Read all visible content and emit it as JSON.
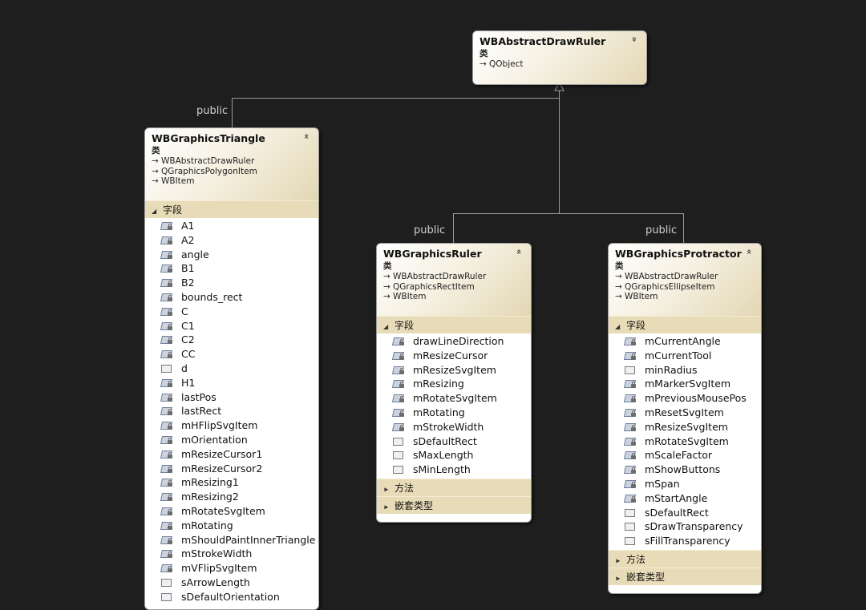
{
  "connector_label": "public",
  "kind_label": "类",
  "collapse_glyph": "«",
  "base_arrow_glyph": "→",
  "classes": {
    "abstract": {
      "name": "WBAbstractDrawRuler",
      "kind": "类",
      "bases": [
        "QObject"
      ]
    },
    "triangle": {
      "name": "WBGraphicsTriangle",
      "kind": "类",
      "bases": [
        "WBAbstractDrawRuler",
        "QGraphicsPolygonItem",
        "WBItem"
      ],
      "sections": [
        {
          "label": "字段",
          "expanded": true
        }
      ],
      "fields": [
        "A1",
        "A2",
        "angle",
        "B1",
        "B2",
        "bounds_rect",
        "C",
        "C1",
        "C2",
        "CC",
        "d",
        "H1",
        "lastPos",
        "lastRect",
        "mHFlipSvgItem",
        "mOrientation",
        "mResizeCursor1",
        "mResizeCursor2",
        "mResizing1",
        "mResizing2",
        "mRotateSvgItem",
        "mRotating",
        "mShouldPaintInnerTriangle",
        "mStrokeWidth",
        "mVFlipSvgItem",
        "sArrowLength",
        "sDefaultOrientation"
      ],
      "field_icons": [
        "lock",
        "lock",
        "lock",
        "lock",
        "lock",
        "lock",
        "lock",
        "lock",
        "lock",
        "lock",
        "plain",
        "lock",
        "lock",
        "lock",
        "lock",
        "lock",
        "lock",
        "lock",
        "lock",
        "lock",
        "lock",
        "lock",
        "lock",
        "lock",
        "lock",
        "plain",
        "plain"
      ]
    },
    "ruler": {
      "name": "WBGraphicsRuler",
      "kind": "类",
      "bases": [
        "WBAbstractDrawRuler",
        "QGraphicsRectItem",
        "WBItem"
      ],
      "sections": [
        {
          "label": "字段",
          "expanded": true
        },
        {
          "label": "方法",
          "expanded": false
        },
        {
          "label": "嵌套类型",
          "expanded": false
        }
      ],
      "fields": [
        "drawLineDirection",
        "mResizeCursor",
        "mResizeSvgItem",
        "mResizing",
        "mRotateSvgItem",
        "mRotating",
        "mStrokeWidth",
        "sDefaultRect",
        "sMaxLength",
        "sMinLength"
      ],
      "field_icons": [
        "lock",
        "lock",
        "lock",
        "lock",
        "lock",
        "lock",
        "lock",
        "plain",
        "plain",
        "plain"
      ]
    },
    "protractor": {
      "name": "WBGraphicsProtractor",
      "kind": "类",
      "bases": [
        "WBAbstractDrawRuler",
        "QGraphicsEllipseItem",
        "WBItem"
      ],
      "sections": [
        {
          "label": "字段",
          "expanded": true
        },
        {
          "label": "方法",
          "expanded": false
        },
        {
          "label": "嵌套类型",
          "expanded": false
        }
      ],
      "fields": [
        "mCurrentAngle",
        "mCurrentTool",
        "minRadius",
        "mMarkerSvgItem",
        "mPreviousMousePos",
        "mResetSvgItem",
        "mResizeSvgItem",
        "mRotateSvgItem",
        "mScaleFactor",
        "mShowButtons",
        "mSpan",
        "mStartAngle",
        "sDefaultRect",
        "sDrawTransparency",
        "sFillTransparency"
      ],
      "field_icons": [
        "lock",
        "lock",
        "plain",
        "lock",
        "lock",
        "lock",
        "lock",
        "lock",
        "lock",
        "lock",
        "lock",
        "lock",
        "plain",
        "plain",
        "plain"
      ]
    }
  },
  "colors": {
    "background": "#1e1e1e",
    "connector": "#9a9a9a",
    "section_bar": "#e8dcb8"
  }
}
